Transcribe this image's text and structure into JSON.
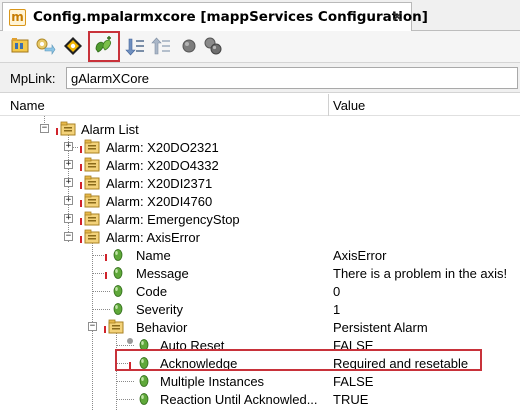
{
  "tab": {
    "title": "Config.mpalarmxcore [mappServices Configuration]",
    "icon": "document-m-icon",
    "close": "✕"
  },
  "toolbar": {
    "buttons": [
      {
        "icon": "module-icon"
      },
      {
        "icon": "settings-arrow-icon"
      },
      {
        "icon": "navigate-icon"
      },
      {
        "icon": "add-green-icon",
        "highlighted": true
      },
      {
        "icon": "move-down-icon"
      },
      {
        "icon": "move-up-icon"
      },
      {
        "icon": "gray-circle-icon"
      },
      {
        "icon": "gray-circles-icon"
      }
    ]
  },
  "mplink": {
    "label": "MpLink:",
    "value": "gAlarmXCore"
  },
  "columns": {
    "name": "Name",
    "value": "Value"
  },
  "tree": {
    "alarm_list": "Alarm List",
    "alarms": [
      "Alarm: X20DO2321",
      "Alarm: X20DO4332",
      "Alarm: X20DI2371",
      "Alarm: X20DI4760",
      "Alarm: EmergencyStop"
    ],
    "axis_error": {
      "label": "Alarm: AxisError",
      "props": [
        {
          "name": "Name",
          "value": "AxisError"
        },
        {
          "name": "Message",
          "value": "There is a problem in the axis!"
        },
        {
          "name": "Code",
          "value": "0"
        },
        {
          "name": "Severity",
          "value": "1"
        }
      ],
      "behavior": {
        "name": "Behavior",
        "value": "Persistent Alarm",
        "props": [
          {
            "name": "Auto Reset",
            "value": "FALSE"
          },
          {
            "name": "Acknowledge",
            "value": "Required and resetable"
          },
          {
            "name": "Multiple Instances",
            "value": "FALSE"
          },
          {
            "name": "Reaction Until Acknowled...",
            "value": "TRUE"
          }
        ]
      }
    }
  },
  "colors": {
    "highlight": "#c8323a",
    "required_marker": "#d0232b",
    "leaf_icon": "#5fa83a"
  }
}
